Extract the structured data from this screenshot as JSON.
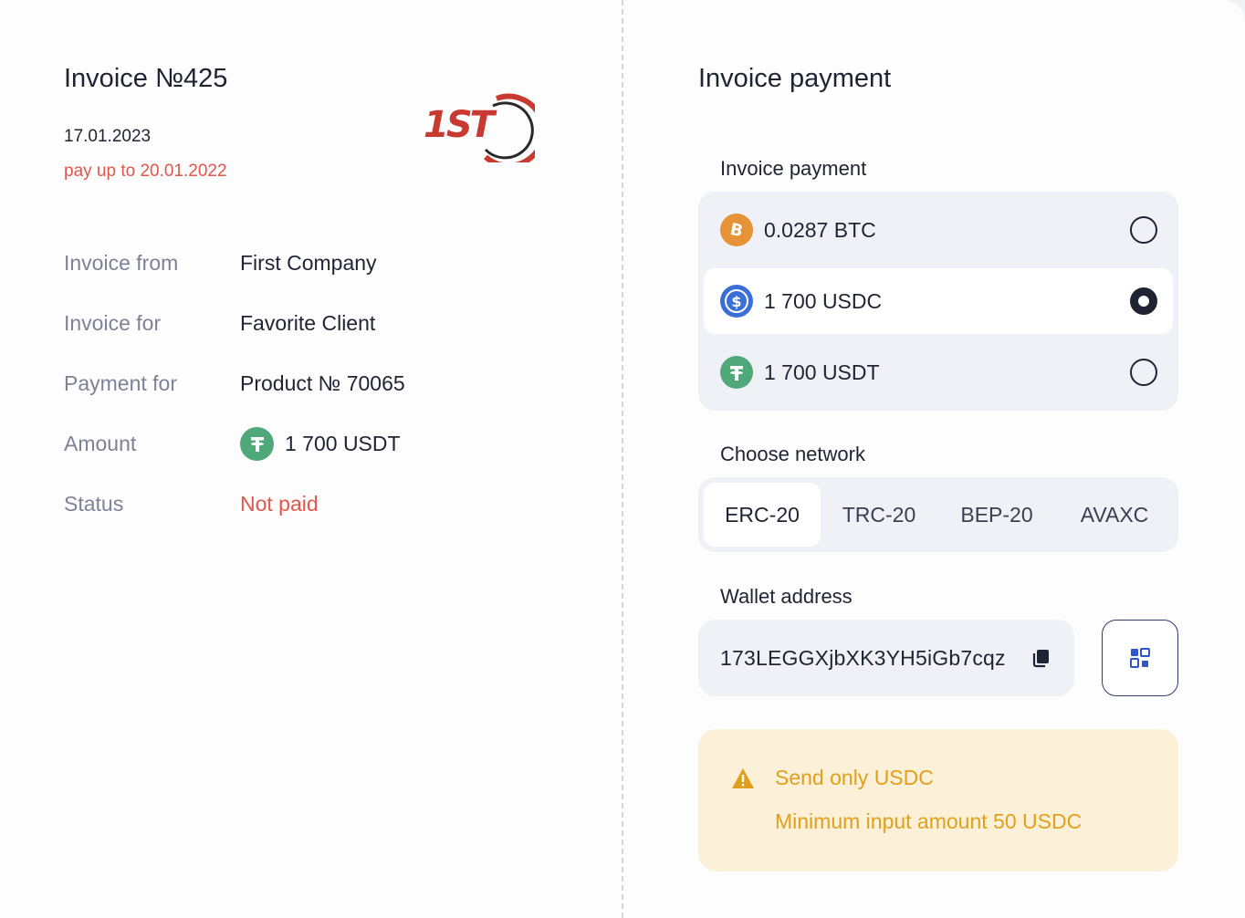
{
  "invoice": {
    "title": "Invoice №425",
    "date": "17.01.2023",
    "due": "pay up to 20.01.2022",
    "logo_text": "1ST",
    "rows": [
      {
        "label": "Invoice from",
        "value": "First Company"
      },
      {
        "label": "Invoice for",
        "value": "Favorite Client"
      },
      {
        "label": "Payment for",
        "value": "Product № 70065"
      },
      {
        "label": "Amount",
        "value": "1 700 USDT",
        "icon": "tether-icon"
      },
      {
        "label": "Status",
        "value": "Not paid"
      }
    ]
  },
  "payment": {
    "title": "Invoice payment",
    "options_label": "Invoice payment",
    "options": [
      {
        "text": "0.0287 BTC",
        "icon": "bitcoin-icon",
        "color": "#e69236",
        "selected": false
      },
      {
        "text": "1 700 USDC",
        "icon": "usdc-icon",
        "color": "#3a6ed9",
        "selected": true
      },
      {
        "text": "1 700 USDT",
        "icon": "tether-icon",
        "color": "#4fa87a",
        "selected": false
      }
    ],
    "network_label": "Choose network",
    "networks": [
      "ERC-20",
      "TRC-20",
      "BEP-20",
      "AVAXC"
    ],
    "network_selected": "ERC-20",
    "wallet_label": "Wallet address",
    "wallet_address": "173LEGGXjbXK3YH5iGb7cqz",
    "warning": {
      "line1": "Send only USDC",
      "line2": "Minimum input amount 50 USDC"
    }
  },
  "colors": {
    "accent_red": "#e2564b",
    "warning": "#e0a01c",
    "warning_bg": "#fcf1d8"
  }
}
